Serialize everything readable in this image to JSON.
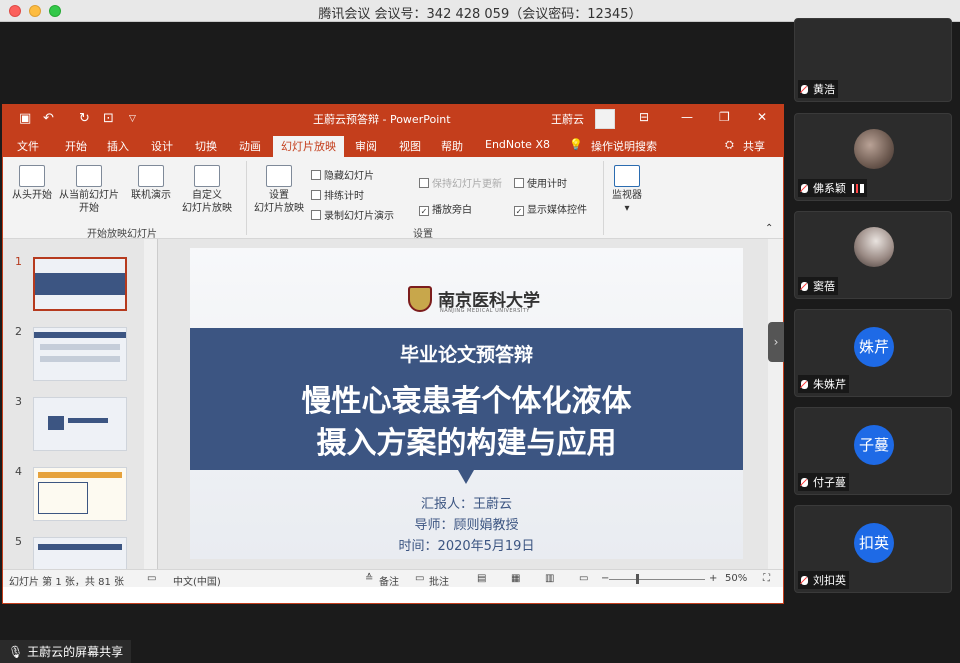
{
  "window": {
    "title": "腾讯会议 会议号：342 428 059（会议密码：12345）"
  },
  "ppt": {
    "title": "王蔚云预答辩 - PowerPoint",
    "user": "王蔚云",
    "tabs": [
      "文件",
      "开始",
      "插入",
      "设计",
      "切换",
      "动画",
      "幻灯片放映",
      "审阅",
      "视图",
      "帮助",
      "EndNote X8",
      "操作说明搜索",
      "共享"
    ],
    "active_tab": "幻灯片放映",
    "ribbon": {
      "from_start": "从头开始",
      "from_current_1": "从当前幻灯片",
      "from_current_2": "开始",
      "online": "联机演示",
      "custom_1": "自定义",
      "custom_2": "幻灯片放映",
      "group1": "开始放映幻灯片",
      "setup_1": "设置",
      "setup_2": "幻灯片放映",
      "hide": "隐藏幻灯片",
      "rehearse": "排练计时",
      "record": "录制幻灯片演示",
      "keep_updated": "保持幻灯片更新",
      "narration": "播放旁白",
      "use_timing": "使用计时",
      "media_controls": "显示媒体控件",
      "group2": "设置",
      "monitor": "监视器"
    },
    "thumbnails": [
      {
        "num": "1",
        "selected": true
      },
      {
        "num": "2",
        "selected": false
      },
      {
        "num": "3",
        "selected": false
      },
      {
        "num": "4",
        "selected": false
      },
      {
        "num": "5",
        "selected": false
      }
    ],
    "slide": {
      "university": "南京医科大学",
      "university_en": "NANJING MEDICAL UNIVERSITY",
      "subtitle": "毕业论文预答辩",
      "title_1": "慢性心衰患者个体化液体",
      "title_2": "摄入方案的构建与应用",
      "reporter": "汇报人：王蔚云",
      "advisor": "导师：顾则娟教授",
      "date": "时间：2020年5月19日"
    },
    "status": {
      "slide_info": "幻灯片 第 1 张，共 81 张",
      "language": "中文(中国)",
      "notes": "备注",
      "comments": "批注",
      "zoom": "50%"
    }
  },
  "sharing_label": "王蔚云的屏幕共享",
  "participants": [
    {
      "name": "黄浩",
      "avatar": ""
    },
    {
      "name": "佛系颖",
      "avatar": "photo"
    },
    {
      "name": "窦蓓",
      "avatar": "photo"
    },
    {
      "name": "朱姝芹",
      "avatar": "姝芹"
    },
    {
      "name": "付子蔓",
      "avatar": "子蔓"
    },
    {
      "name": "刘扣英",
      "avatar": "扣英"
    }
  ]
}
